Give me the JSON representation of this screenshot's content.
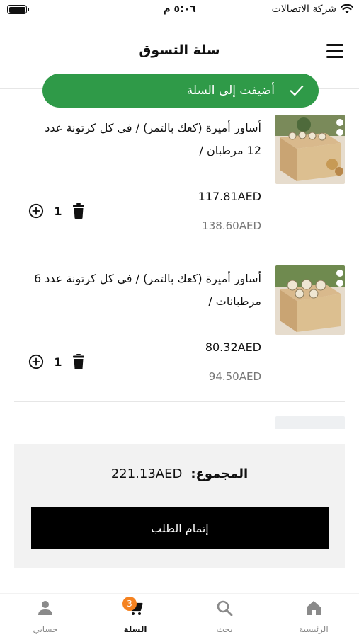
{
  "status_bar": {
    "time": "٥:٠٦ م",
    "carrier": "شركة الاتصالات"
  },
  "header": {
    "title": "سلة التسوق"
  },
  "toast": {
    "message": "أضيفت إلى السلة",
    "color": "#2f9a48"
  },
  "cart": {
    "items": [
      {
        "name": "أساور أميرة (كعك بالتمر) / في كل كرتونة عدد 12 مرطبان /",
        "price": "117.81AED",
        "old_price": "138.60AED",
        "quantity": "1"
      },
      {
        "name": "أساور أميرة (كعك بالتمر) / في كل كرتونة عدد 6 مرطبانات /",
        "price": "80.32AED",
        "old_price": "94.50AED",
        "quantity": "1"
      }
    ]
  },
  "summary": {
    "total_label": "المجموع:",
    "total_value": "221.13AED",
    "checkout_label": "إتمام الطلب"
  },
  "bottom_nav": {
    "items": [
      {
        "label": "حسابي",
        "icon": "person-icon"
      },
      {
        "label": "السلة",
        "icon": "cart-icon",
        "badge": "3",
        "active": true
      },
      {
        "label": "بحث",
        "icon": "search-icon"
      },
      {
        "label": "الرئيسية",
        "icon": "home-icon"
      }
    ],
    "badge_color": "#f58220"
  }
}
